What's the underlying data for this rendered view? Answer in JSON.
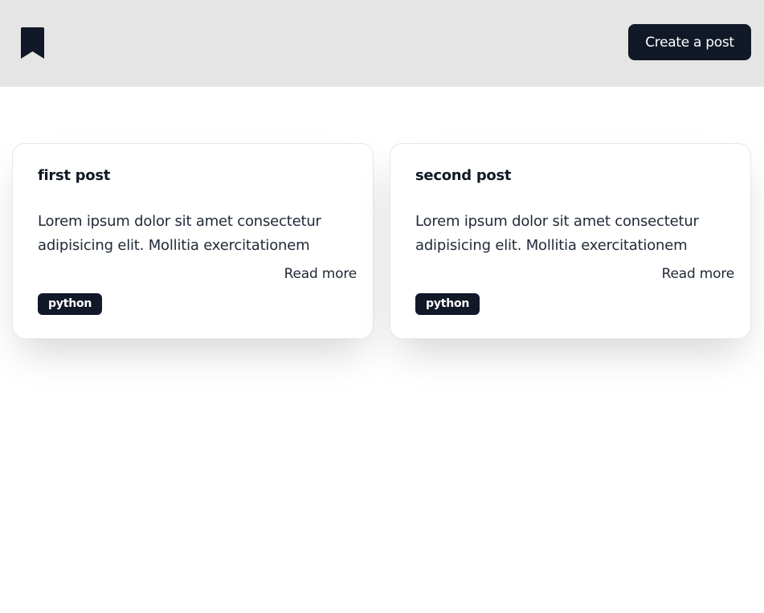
{
  "navbar": {
    "logo_icon": "bookmark-icon",
    "create_button_label": "Create a post",
    "background": "#e5e5e5",
    "accent": "#111827"
  },
  "posts": [
    {
      "title": "first post",
      "body_line1": "Lorem ipsum dolor sit amet consectetur",
      "body_line2": "adipisicing elit. Mollitia exercitationem",
      "read_more": "Read more",
      "tag": "python"
    },
    {
      "title": "second post",
      "body_line1": "Lorem ipsum dolor sit amet consectetur",
      "body_line2": "adipisicing elit. Mollitia exercitationem",
      "read_more": "Read more",
      "tag": "python"
    }
  ]
}
